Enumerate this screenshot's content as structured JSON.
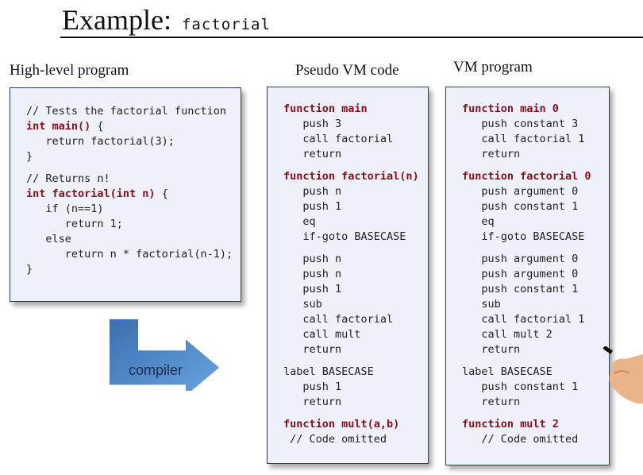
{
  "title": {
    "main": "Example:",
    "code": "factorial"
  },
  "headings": {
    "high_level": "High-level program",
    "pseudo_vm": "Pseudo VM code",
    "vm_program": "VM program"
  },
  "compiler_label": "compiler",
  "high_level_code": [
    {
      "t": "// Tests the factorial function"
    },
    {
      "t": "int main() {",
      "kw": "int main()",
      "rest": " {"
    },
    {
      "t": "   return factorial(3);"
    },
    {
      "t": "}"
    },
    {
      "gap": true
    },
    {
      "t": "// Returns n!"
    },
    {
      "t": "int factorial(int n) {",
      "kw": "int factorial(int n)",
      "rest": " {"
    },
    {
      "t": "   if (n==1)"
    },
    {
      "t": "      return 1;"
    },
    {
      "t": "   else"
    },
    {
      "t": "      return n * factorial(n-1);"
    },
    {
      "t": "}"
    }
  ],
  "pseudo_vm_code": [
    {
      "t": "function main",
      "kw": "function main",
      "rest": ""
    },
    {
      "t": "   push 3"
    },
    {
      "t": "   call factorial"
    },
    {
      "t": "   return"
    },
    {
      "gap": true
    },
    {
      "t": "function factorial(n)",
      "kw": "function factorial(n)",
      "rest": ""
    },
    {
      "t": "   push n"
    },
    {
      "t": "   push 1"
    },
    {
      "t": "   eq"
    },
    {
      "t": "   if-goto BASECASE"
    },
    {
      "gap": true
    },
    {
      "t": "   push n"
    },
    {
      "t": "   push n"
    },
    {
      "t": "   push 1"
    },
    {
      "t": "   sub"
    },
    {
      "t": "   call factorial"
    },
    {
      "t": "   call mult"
    },
    {
      "t": "   return"
    },
    {
      "gap": true
    },
    {
      "t": "label BASECASE"
    },
    {
      "t": "   push 1"
    },
    {
      "t": "   return"
    },
    {
      "gap": true
    },
    {
      "t": "function mult(a,b)",
      "kw": "function mult(a,b)",
      "rest": ""
    },
    {
      "t": " // Code omitted"
    }
  ],
  "vm_program_code": [
    {
      "t": "function main 0",
      "kw": "function main 0",
      "rest": ""
    },
    {
      "t": "   push constant 3"
    },
    {
      "t": "   call factorial 1"
    },
    {
      "t": "   return"
    },
    {
      "gap": true
    },
    {
      "t": "function factorial 0",
      "kw": "function factorial 0",
      "rest": ""
    },
    {
      "t": "   push argument 0"
    },
    {
      "t": "   push constant 1"
    },
    {
      "t": "   eq"
    },
    {
      "t": "   if-goto BASECASE"
    },
    {
      "gap": true
    },
    {
      "t": "   push argument 0"
    },
    {
      "t": "   push argument 0"
    },
    {
      "t": "   push constant 1"
    },
    {
      "t": "   sub"
    },
    {
      "t": "   call factorial 1"
    },
    {
      "t": "   call mult 2"
    },
    {
      "t": "   return"
    },
    {
      "gap": true
    },
    {
      "t": "label BASECASE"
    },
    {
      "t": "   push constant 1"
    },
    {
      "t": "   return"
    },
    {
      "gap": true
    },
    {
      "t": "function mult 2",
      "kw": "function mult 2",
      "rest": ""
    },
    {
      "t": "   // Code omitted"
    }
  ],
  "colors": {
    "keyword": "#8b0e1b",
    "box_bg": "#eef0fa",
    "arrow": "#4a86c8"
  }
}
